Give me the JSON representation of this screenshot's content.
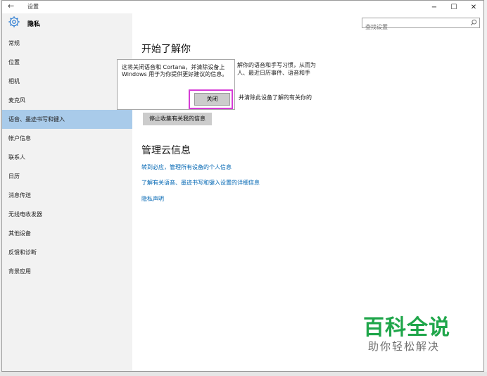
{
  "titlebar": {
    "back_glyph": "←",
    "app_title": "设置",
    "minimize_glyph": "−",
    "maximize_glyph": "☐",
    "close_glyph": "✕"
  },
  "sidebar": {
    "section_title": "隐私",
    "items": [
      {
        "label": "常规"
      },
      {
        "label": "位置"
      },
      {
        "label": "相机"
      },
      {
        "label": "麦克风"
      },
      {
        "label": "语音、墨迹书写和键入",
        "active": true
      },
      {
        "label": "帐户信息"
      },
      {
        "label": "联系人"
      },
      {
        "label": "日历"
      },
      {
        "label": "消息传送"
      },
      {
        "label": "无线电收发器"
      },
      {
        "label": "其他设备"
      },
      {
        "label": "反馈和诊断"
      },
      {
        "label": "背景应用"
      }
    ]
  },
  "search": {
    "placeholder": "查找设置",
    "icon": "search-icon"
  },
  "main": {
    "heading1": "开始了解你",
    "desc_line1": "解你的语音和手写习惯，从而为",
    "desc_line2": "人、最近日历事件、语音和手",
    "desc_line3": "并清除此设备了解的有关你的",
    "stop_button": "停止收集有关我的信息",
    "heading2": "管理云信息",
    "link1": "转到必应，管理所有设备的个人信息",
    "link2": "了解有关语音、墨迹书写和键入设置的详细信息",
    "link3": "隐私声明"
  },
  "popup": {
    "text": "这将关闭语音和 Cortana，并清除设备上 Windows 用于为你提供更好建议的信息。",
    "close_button": "关闭"
  },
  "watermark": {
    "main": "百科全说",
    "sub": "助你轻松解决"
  },
  "colors": {
    "accent_link": "#0066b3",
    "active_nav": "#a9cbea",
    "highlight_border": "#d63cd6",
    "watermark_green": "#1fa64a"
  }
}
